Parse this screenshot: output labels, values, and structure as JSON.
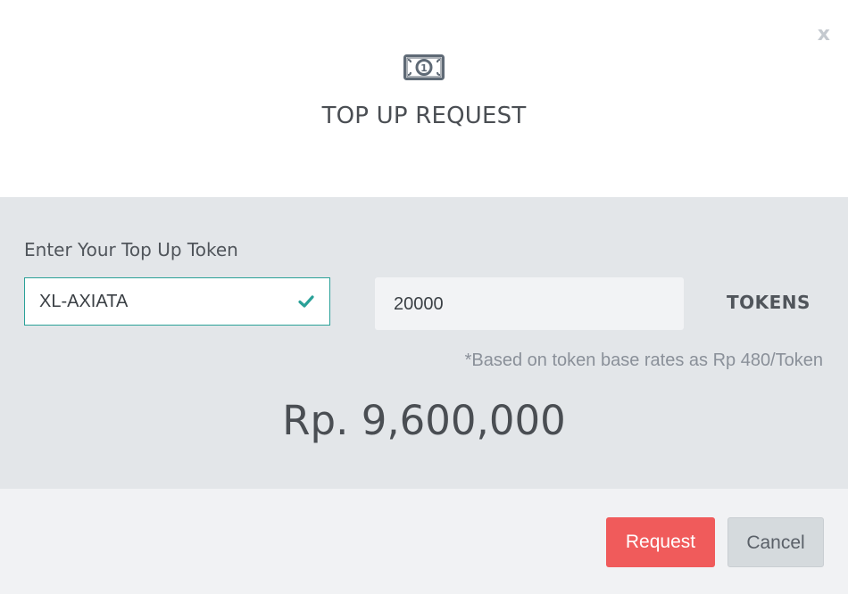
{
  "dialog": {
    "close_label": "x",
    "icon": "money-bill-icon",
    "icon_number": "1",
    "title": "TOP UP REQUEST"
  },
  "form": {
    "label": "Enter Your Top Up Token",
    "token_code_value": "XL-AXIATA",
    "token_code_status_icon": "check-icon",
    "token_amount_value": "20000",
    "token_unit": "TOKENS",
    "rate_note": "*Based on token base rates as Rp 480/Token",
    "total": "Rp. 9,600,000"
  },
  "footer": {
    "request_label": "Request",
    "cancel_label": "Cancel"
  },
  "colors": {
    "accent_valid": "#2aa198",
    "request_button": "#f05b5b",
    "cancel_button": "#d5dadd",
    "body_background": "#e3e6e9"
  }
}
